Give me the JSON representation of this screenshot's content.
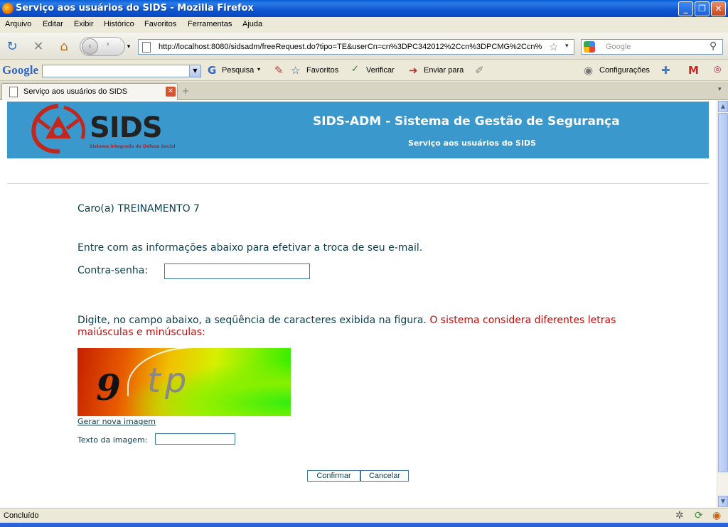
{
  "window": {
    "title": "Serviço aos usuários do SIDS - Mozilla Firefox"
  },
  "menu": [
    "Arquivo",
    "Editar",
    "Exibir",
    "Histórico",
    "Favoritos",
    "Ferramentas",
    "Ajuda"
  ],
  "nav": {
    "url": "http://localhost:8080/sidsadm/freeRequest.do?tipo=TE&userCn=cn%3DPC342012%2Ccn%3DPCMG%2Ccn%3D",
    "search_placeholder": "Google"
  },
  "gtoolbar": {
    "logo": "Google",
    "pesquisa": "Pesquisa",
    "favoritos": "Favoritos",
    "verificar": "Verificar",
    "enviar": "Enviar para",
    "configuracoes": "Configurações"
  },
  "tab": {
    "label": "Serviço aos usuários do SIDS"
  },
  "page": {
    "logo_text": "SIDS",
    "logo_sub": "Sistema Integrado de Defesa Social",
    "header_title": "SIDS-ADM - Sistema de Gestão de Segurança",
    "header_subtitle": "Serviço aos usuários do SIDS",
    "greeting": "Caro(a) TREINAMENTO 7",
    "instructions": "Entre com as informações abaixo para efetivar a troca de seu e-mail.",
    "contra_senha_label": "Contra-senha:",
    "contra_senha_value": "",
    "captcha_instr": "Digite, no campo abaixo, a seqüência de caracteres exibida na figura.",
    "captcha_warning": "O sistema considera diferentes letras maiúsculas e minúsculas:",
    "captcha_chars_dark": "9",
    "captcha_chars_light": "tp",
    "new_image_link": "Gerar nova imagem",
    "image_text_label": "Texto da imagem:",
    "image_text_value": "",
    "confirm_button": "Confirmar",
    "cancel_button": "Cancelar"
  },
  "status": {
    "text": "Concluído"
  }
}
